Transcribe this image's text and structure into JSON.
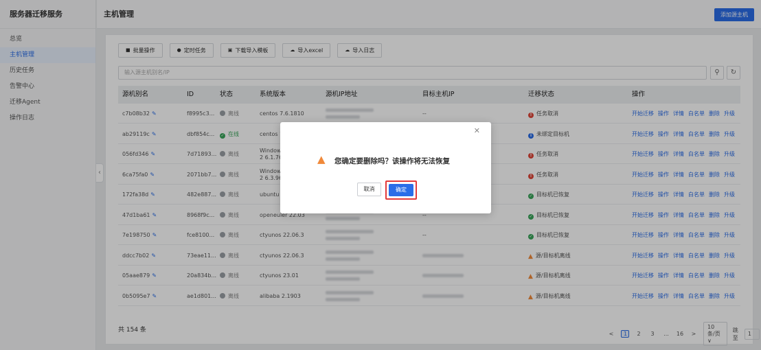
{
  "sidebar": {
    "title": "服务器迁移服务",
    "items": [
      {
        "label": "总览",
        "active": false
      },
      {
        "label": "主机管理",
        "active": true
      },
      {
        "label": "历史任务",
        "active": false
      },
      {
        "label": "告警中心",
        "active": false
      },
      {
        "label": "迁移Agent",
        "active": false
      },
      {
        "label": "操作日志",
        "active": false
      }
    ],
    "collapse_icon": "chevron-left-icon"
  },
  "header": {
    "title": "主机管理",
    "add_button": "添加源主机"
  },
  "toolbar": {
    "batch": "批量操作",
    "timer": "定时任务",
    "download": "下载导入模板",
    "import_excel": "导入excel",
    "import_log": "导入日志"
  },
  "search": {
    "placeholder": "输入源主机别名/IP",
    "search_icon": "search-icon",
    "refresh_icon": "refresh-icon"
  },
  "table": {
    "headers": {
      "alias": "源机别名",
      "id": "ID",
      "status": "状态",
      "os": "系统版本",
      "src_ip": "源机IP地址",
      "dst_ip": "目标主机IP",
      "mig": "迁移状态",
      "ops": "操作"
    },
    "rows": [
      {
        "alias": "c7b08b32",
        "id": "f8995c3...",
        "status": "离线",
        "os": "centos 7.6.1810",
        "os2": "",
        "dst": "--",
        "mig": "任务取消"
      },
      {
        "alias": "ab29119c",
        "id": "dbf854c...",
        "status": "在线",
        "os": "centos 7",
        "os2": "",
        "dst": "",
        "mig": "未绑定目标机"
      },
      {
        "alias": "056fd346",
        "id": "7d71893...",
        "status": "离线",
        "os": "Window",
        "os2": "2 6.1.76",
        "dst": "",
        "mig": "任务取消"
      },
      {
        "alias": "6ca75fa0",
        "id": "2071bb7...",
        "status": "离线",
        "os": "Window",
        "os2": "2 6.3.96",
        "dst": "",
        "mig": "任务取消"
      },
      {
        "alias": "172fa38d",
        "id": "482e887...",
        "status": "离线",
        "os": "ubuntu",
        "os2": "",
        "dst": "",
        "mig": "目标机已恢复"
      },
      {
        "alias": "47d1ba61",
        "id": "8968f9c...",
        "status": "离线",
        "os": "openeuler 22.03",
        "os2": "",
        "dst": "--",
        "mig": "目标机已恢复"
      },
      {
        "alias": "7e198750",
        "id": "fce8100...",
        "status": "离线",
        "os": "ctyunos 22.06.3",
        "os2": "",
        "dst": "--",
        "mig": "目标机已恢复"
      },
      {
        "alias": "ddcc7b02",
        "id": "73eae11...",
        "status": "离线",
        "os": "ctyunos 22.06.3",
        "os2": "",
        "dst": "",
        "mig": "源/目标机离线"
      },
      {
        "alias": "05aae879",
        "id": "20a834b...",
        "status": "离线",
        "os": "ctyunos 23.01",
        "os2": "",
        "dst": "",
        "mig": "源/目标机离线"
      },
      {
        "alias": "0b5095e7",
        "id": "ae1d801...",
        "status": "离线",
        "os": "alibaba 2.1903",
        "os2": "",
        "dst": "",
        "mig": "源/目标机离线"
      }
    ],
    "ops": [
      "开始迁移",
      "操作",
      "详情",
      "白名单",
      "删除",
      "升级"
    ]
  },
  "footer": {
    "total": "共 154 条",
    "prev": "<",
    "next": ">",
    "pages": [
      "1",
      "2",
      "3",
      "...",
      "16"
    ],
    "page_size": "10 条/页 ∨",
    "jump_label": "跳至",
    "jump_value": "1",
    "page_unit": "页"
  },
  "dialog": {
    "message": "您确定要删除吗？该操作将无法恢复",
    "cancel": "取消",
    "confirm": "确定",
    "close_icon": "close-icon",
    "warning_icon": "warning-icon",
    "highlight_color": "#e33a3a"
  },
  "colors": {
    "accent": "#2a6de8",
    "error": "#e0473a",
    "success": "#3aa55a",
    "warning": "#f0893a"
  }
}
